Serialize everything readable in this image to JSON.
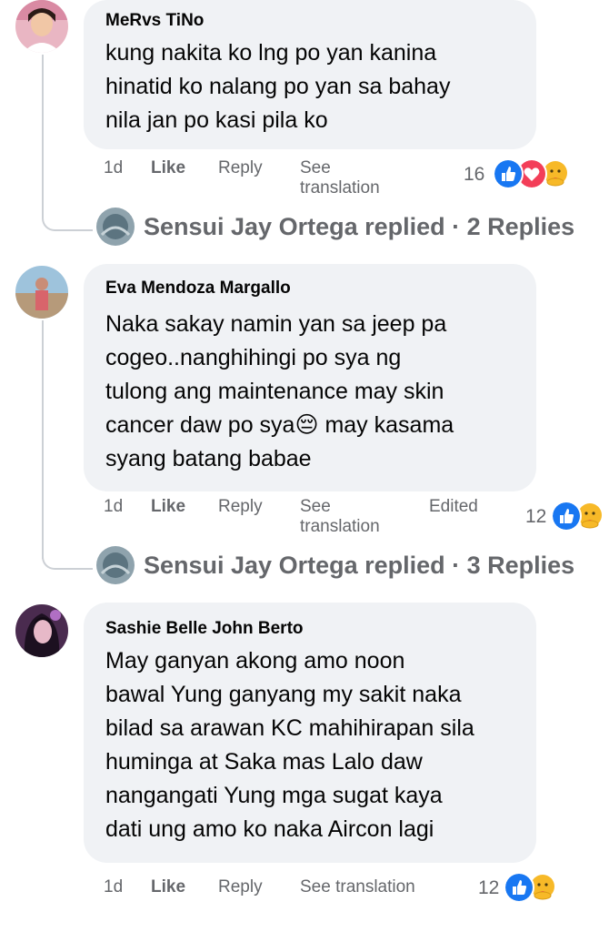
{
  "comments": [
    {
      "author": "MeRvs TiNo",
      "text": "kung nakita ko lng po yan kanina\nhinatid ko nalang po yan sa bahay\nnila jan po kasi pila ko",
      "time": "1d",
      "like": "Like",
      "reply": "Reply",
      "see_translation": "See\ntranslation",
      "reaction_count": "16",
      "reactions": [
        "like-icon",
        "love-icon",
        "care-icon"
      ],
      "replies": {
        "name": "Sensui Jay Ortega",
        "text": "Sensui Jay Ortega replied · 2 Replies"
      }
    },
    {
      "author": "Eva Mendoza Margallo",
      "text": "Naka sakay namin yan sa jeep pa\ncogeo..nanghihingi po sya ng\ntulong ang maintenance may skin\ncancer daw po sya😔 may kasama\nsyang batang babae",
      "time": "1d",
      "like": "Like",
      "reply": "Reply",
      "see_translation": "See\ntranslation",
      "edited": "Edited",
      "reaction_count": "12",
      "reactions": [
        "like-icon",
        "care-icon"
      ],
      "replies": {
        "name": "Sensui Jay Ortega",
        "text": "Sensui Jay Ortega replied · 3 Replies"
      }
    },
    {
      "author": "Sashie Belle John Berto",
      "text": "May ganyan akong amo noon\nbawal Yung ganyang my sakit naka\nbilad sa arawan KC mahihirapan sila\nhuminga at Saka mas Lalo daw\nnangangati Yung mga sugat kaya\ndati ung amo ko naka Aircon lagi",
      "time": "1d",
      "like": "Like",
      "reply": "Reply",
      "see_translation": "See translation",
      "reaction_count": "12",
      "reactions": [
        "like-icon",
        "care-icon"
      ]
    }
  ],
  "colors": {
    "bubble": "#f0f2f5",
    "meta_text": "#65676b",
    "like_blue": "#1877f2",
    "love_red": "#f33e58",
    "care_yellow": "#f7b928",
    "thread_line": "#ccd0d5"
  }
}
